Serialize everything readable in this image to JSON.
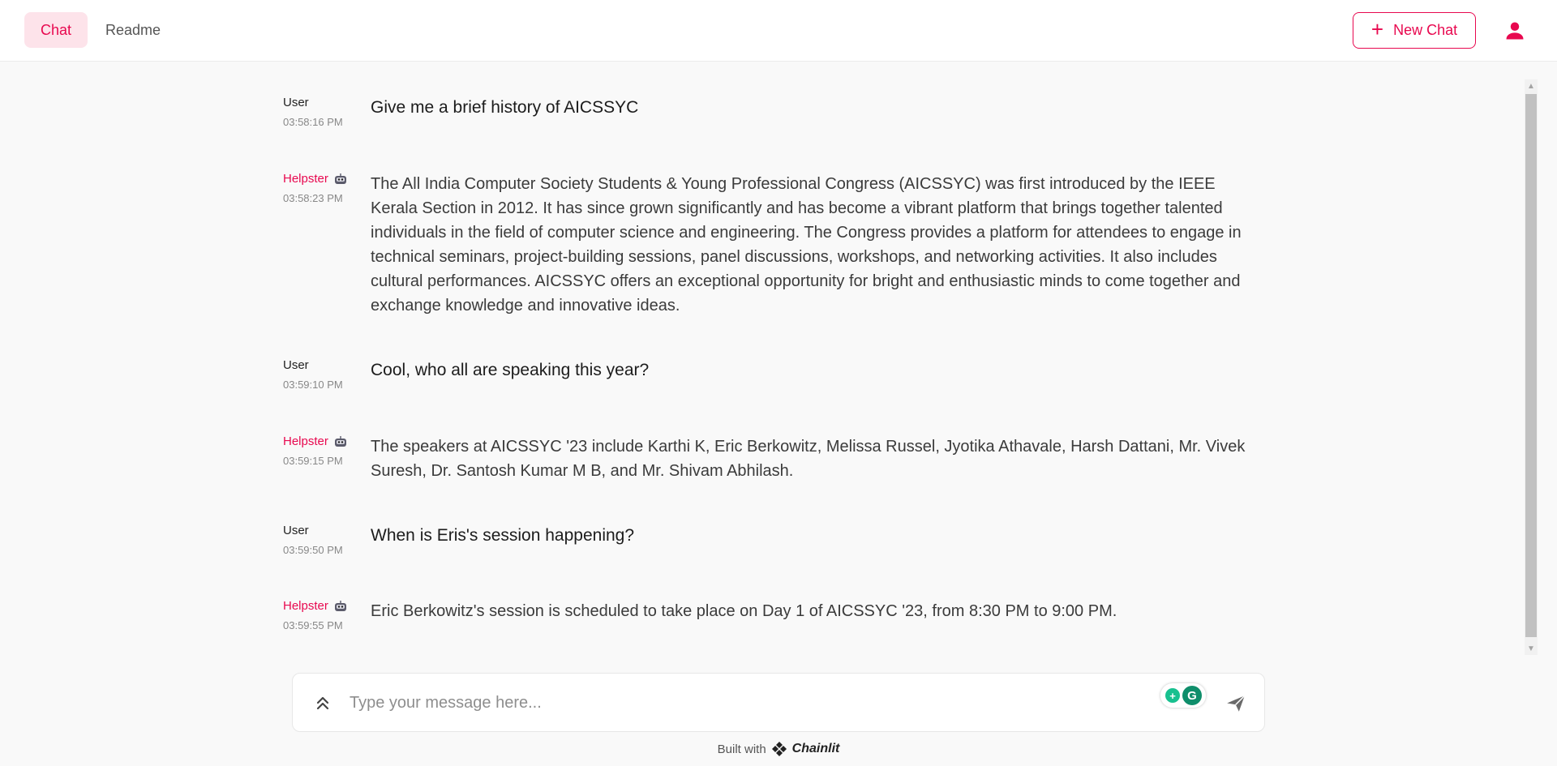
{
  "header": {
    "tabs": [
      {
        "label": "Chat",
        "active": true
      },
      {
        "label": "Readme",
        "active": false
      }
    ],
    "new_chat_label": "New Chat",
    "user_icon": "user-icon"
  },
  "messages": [
    {
      "author": "User",
      "time": "03:58:16 PM",
      "text": "Give me a brief history of AICSSYC",
      "role": "user"
    },
    {
      "author": "Helpster",
      "time": "03:58:23 PM",
      "role": "bot",
      "text": "The All India Computer Society Students & Young Professional Congress (AICSSYC) was first introduced by the IEEE Kerala Section in 2012. It has since grown significantly and has become a vibrant platform that brings together talented individuals in the field of computer science and engineering. The Congress provides a platform for attendees to engage in technical seminars, project-building sessions, panel discussions, workshops, and networking activities. It also includes cultural performances. AICSSYC offers an exceptional opportunity for bright and enthusiastic minds to come together and exchange knowledge and innovative ideas."
    },
    {
      "author": "User",
      "time": "03:59:10 PM",
      "text": "Cool, who all are speaking this year?",
      "role": "user"
    },
    {
      "author": "Helpster",
      "time": "03:59:15 PM",
      "role": "bot",
      "text": "The speakers at AICSSYC '23 include Karthi K, Eric Berkowitz, Melissa Russel, Jyotika Athavale, Harsh Dattani, Mr. Vivek Suresh, Dr. Santosh Kumar M B, and Mr. Shivam Abhilash."
    },
    {
      "author": "User",
      "time": "03:59:50 PM",
      "text": "When is Eris's session happening?",
      "role": "user"
    },
    {
      "author": "Helpster",
      "time": "03:59:55 PM",
      "role": "bot",
      "text": "Eric Berkowitz's session is scheduled to take place on Day 1 of AICSSYC '23, from 8:30 PM to 9:00 PM."
    }
  ],
  "input": {
    "placeholder": "Type your message here...",
    "value": ""
  },
  "footer": {
    "built_with": "Built with",
    "brand": "Chainlit"
  },
  "colors": {
    "accent": "#e8084f",
    "accent_bg": "#fde3ea",
    "page_bg": "#f9f9f9"
  }
}
